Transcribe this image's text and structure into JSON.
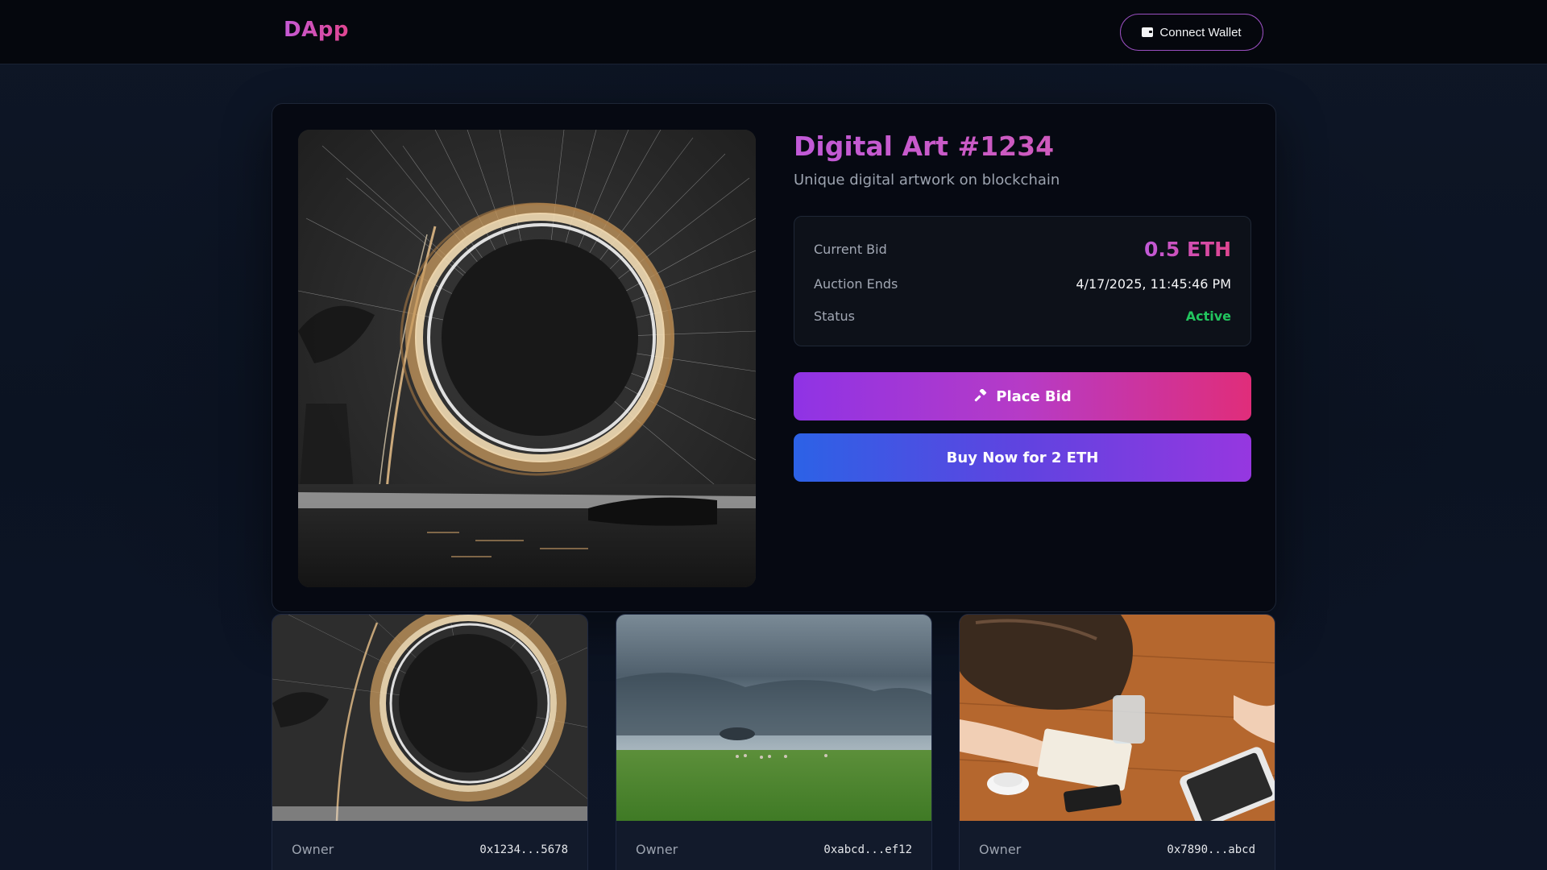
{
  "header": {
    "logo": "DApp",
    "connect_wallet_label": "Connect Wallet",
    "connect_wallet_icon": "wallet-icon"
  },
  "nft": {
    "title": "Digital Art #1234",
    "description": "Unique digital artwork on blockchain",
    "image": "spinning-steel-wool-light-circle",
    "current_bid_label": "Current Bid",
    "current_bid_value": "0.5 ETH",
    "auction_ends_label": "Auction Ends",
    "auction_ends_value": "4/17/2025, 11:45:46 PM",
    "status_label": "Status",
    "status_value": "Active",
    "place_bid_label": "Place Bid",
    "place_bid_icon": "gavel-icon",
    "buy_now_label": "Buy Now for 2 ETH"
  },
  "gallery": [
    {
      "image": "spinning-steel-wool-light-circle",
      "owner_label": "Owner",
      "owner_address": "0x1234...5678"
    },
    {
      "image": "stormy-sky-over-green-field",
      "owner_label": "Owner",
      "owner_address": "0xabcd...ef12"
    },
    {
      "image": "people-writing-at-wooden-table",
      "owner_label": "Owner",
      "owner_address": "0x7890...abcd"
    }
  ],
  "colors": {
    "accent_purple": "#9333ea",
    "accent_pink": "#db2777",
    "accent_blue": "#2563eb",
    "status_active": "#22c55e",
    "background": "#0b1120"
  }
}
